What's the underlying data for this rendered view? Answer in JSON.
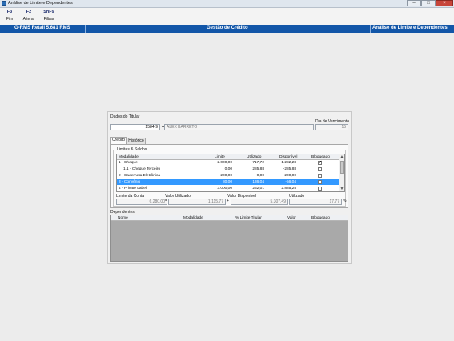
{
  "window": {
    "title": "Análise de Limite e Dependentes"
  },
  "toolbar": {
    "buttons": [
      {
        "key": "F3",
        "label": "Fim"
      },
      {
        "key": "F2",
        "label": "Alterar"
      },
      {
        "key": "ShF9",
        "label": "Filtrar"
      }
    ]
  },
  "banner": {
    "left": "G-RMS Retail 5.681 RMS",
    "center": "Gestão de Crédito",
    "right": "Análise de Limite e Dependentes"
  },
  "titular": {
    "group_label": "Dados do Titular",
    "code": "1584-9",
    "name": "ALEX BARRETO",
    "due_label": "Dia de Vencimento",
    "due_day": "15"
  },
  "tabs": [
    "Crédito",
    "Histórico"
  ],
  "limits": {
    "group_label": "Limites & Saldos",
    "columns": [
      "Modalidade",
      "Limite",
      "Utilizado",
      "Disponível",
      "Bloqueado"
    ],
    "rows": [
      {
        "modalidade": "1 - Cheque",
        "limite": "2.000,00",
        "utilizado": "717,72",
        "disponivel": "1.282,28",
        "bloqueado": true
      },
      {
        "modalidade": "1.1 - Cheque Terceiro",
        "limite": "0,00",
        "utilizado": "285,88",
        "disponivel": "-285,88",
        "bloqueado": false
      },
      {
        "modalidade": "2 - Caderneta Eletrônica",
        "limite": "200,00",
        "utilizado": "0,00",
        "disponivel": "200,00",
        "bloqueado": false
      },
      {
        "modalidade": "3 - Convênio",
        "limite": "80,00",
        "utilizado": "136,04",
        "disponivel": "-56,04",
        "bloqueado": false
      },
      {
        "modalidade": "4 - Private Label",
        "limite": "3.000,00",
        "utilizado": "262,01",
        "disponivel": "2.885,25",
        "bloqueado": false
      }
    ],
    "selected_index": 3,
    "totals": {
      "limite_label": "Limite da Conta",
      "limite_value": "6.280,00",
      "utilizado_label": "Valor Utilizado",
      "utilizado_value": "1.115,77",
      "disponivel_label": "Valor Disponível",
      "disponivel_value": "5.307,49",
      "pct_label": "Utilizado",
      "pct_value": "17,77"
    }
  },
  "dependentes": {
    "group_label": "Dependentes",
    "columns": [
      "Nome",
      "Modalidade",
      "% Limite Titular",
      "Valor",
      "Bloqueado"
    ]
  },
  "colors": {
    "banner": "#1256a8",
    "selection": "#3399ff"
  }
}
